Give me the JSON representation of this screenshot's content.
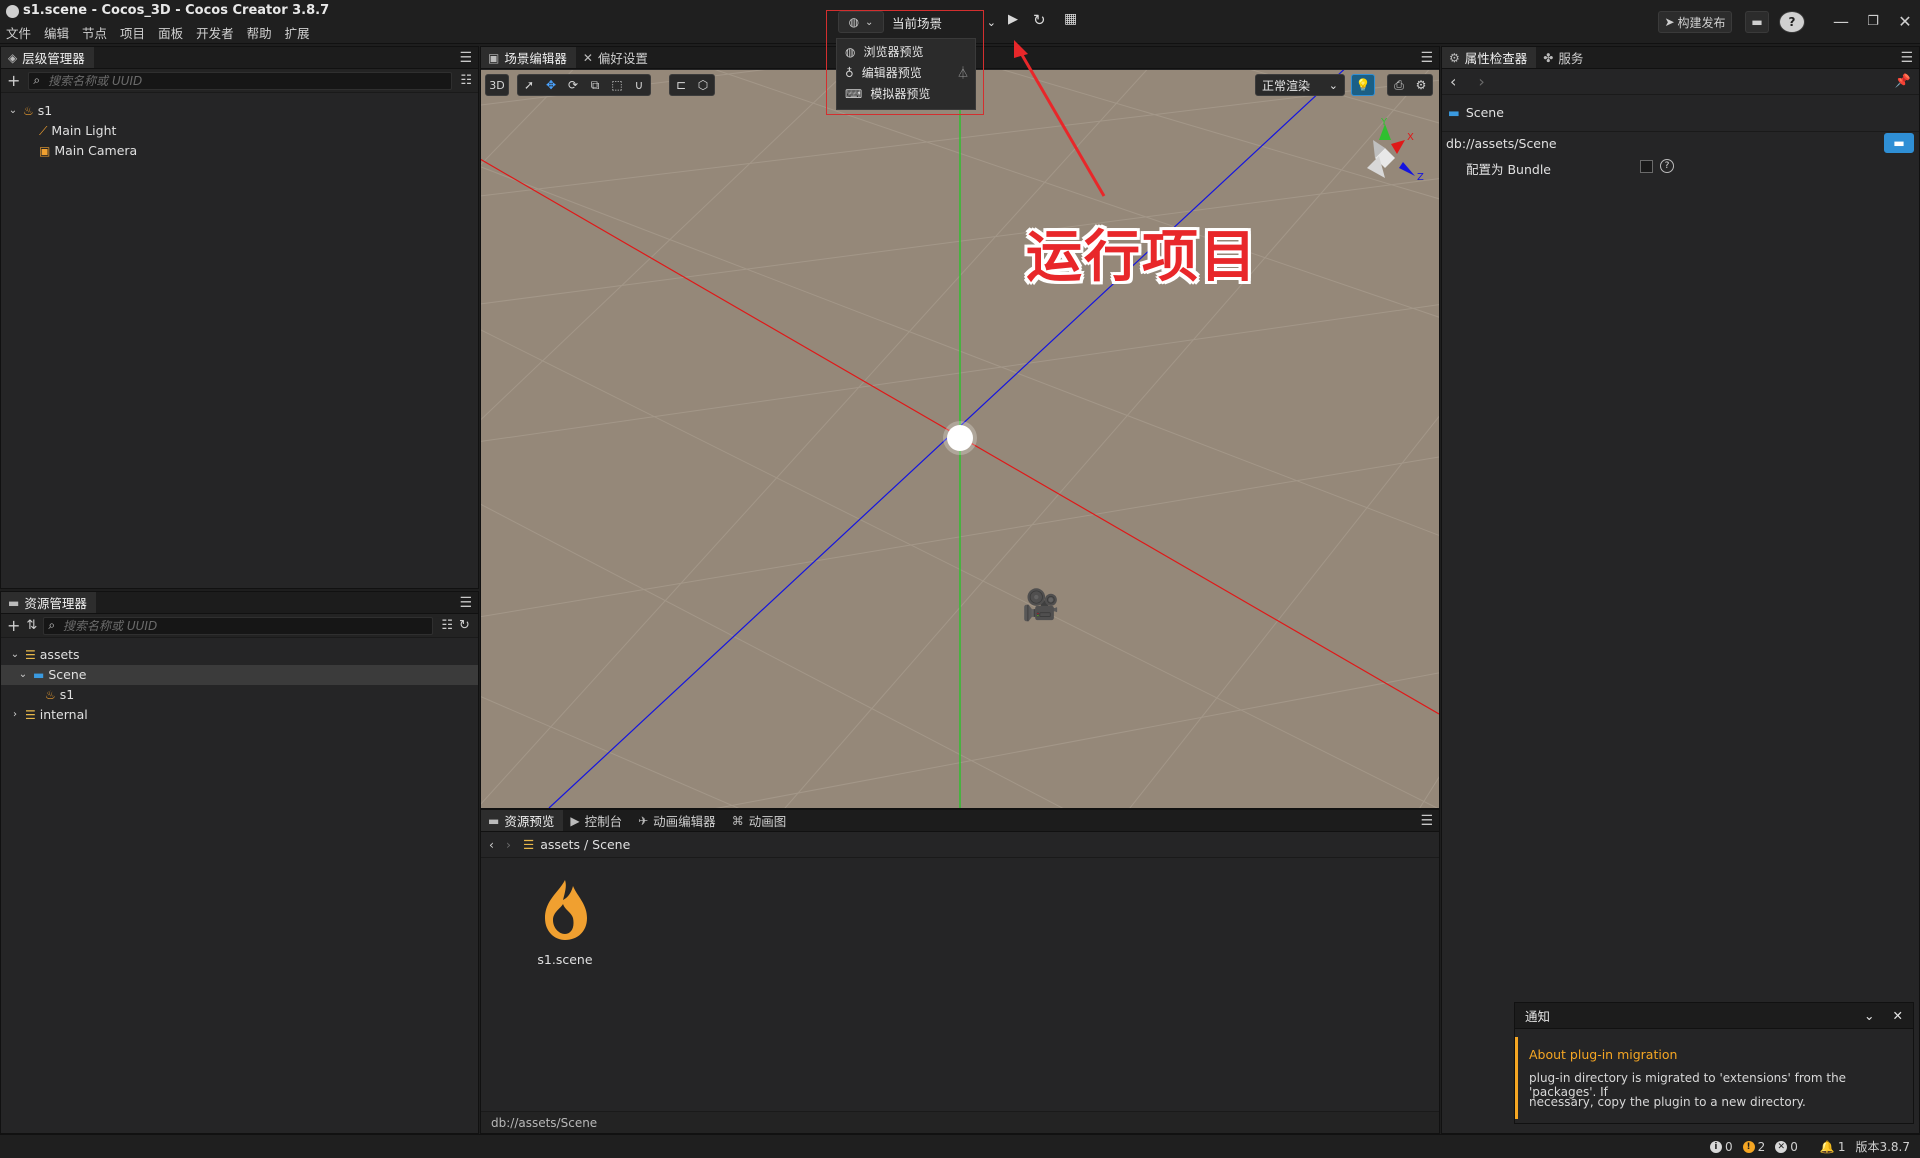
{
  "window": {
    "title": "s1.scene - Cocos_3D - Cocos Creator 3.8.7",
    "menu": [
      "文件",
      "编辑",
      "节点",
      "项目",
      "面板",
      "开发者",
      "帮助",
      "扩展"
    ]
  },
  "toolbar": {
    "preview_target": "当前场景",
    "build_label": "构建发布",
    "preview_menu": [
      "浏览器预览",
      "编辑器预览",
      "模拟器预览"
    ]
  },
  "hierarchy": {
    "tab": "层级管理器",
    "search_placeholder": "搜索名称或 UUID",
    "nodes": [
      {
        "label": "s1"
      },
      {
        "label": "Main Light"
      },
      {
        "label": "Main Camera"
      }
    ]
  },
  "assets": {
    "tab": "资源管理器",
    "search_placeholder": "搜索名称或 UUID",
    "items": [
      {
        "label": "assets"
      },
      {
        "label": "Scene"
      },
      {
        "label": "s1"
      },
      {
        "label": "internal"
      }
    ]
  },
  "scene_editor": {
    "tabs": [
      "场景编辑器",
      "偏好设置"
    ],
    "mode_3d": "3D",
    "render_mode": "正常渲染",
    "annotation": "运行项目",
    "gizmo_axes": [
      "Y",
      "X",
      "Z"
    ]
  },
  "asset_preview": {
    "tabs": [
      "资源预览",
      "控制台",
      "动画编辑器",
      "动画图"
    ],
    "breadcrumb": "assets / Scene",
    "file_name": "s1.scene",
    "footer_path": "db://assets/Scene"
  },
  "inspector": {
    "tabs": [
      "属性检查器",
      "服务"
    ],
    "asset_name": "Scene",
    "asset_path": "db://assets/Scene",
    "bundle_label": "配置为 Bundle"
  },
  "notification": {
    "header": "通知",
    "title": "About plug-in migration",
    "line1": "plug-in directory is migrated to 'extensions' from the 'packages'. If",
    "line2": "necessary, copy the plugin to a new directory."
  },
  "status": {
    "info_count": "0",
    "warn_count": "2",
    "error_count": "0",
    "notify_count": "1",
    "version": "版本3.8.7"
  },
  "colors": {
    "accent": "#2f8fd5",
    "warning": "#f5a623",
    "annotation": "#e8272a",
    "viewport_ground": "#958879"
  }
}
